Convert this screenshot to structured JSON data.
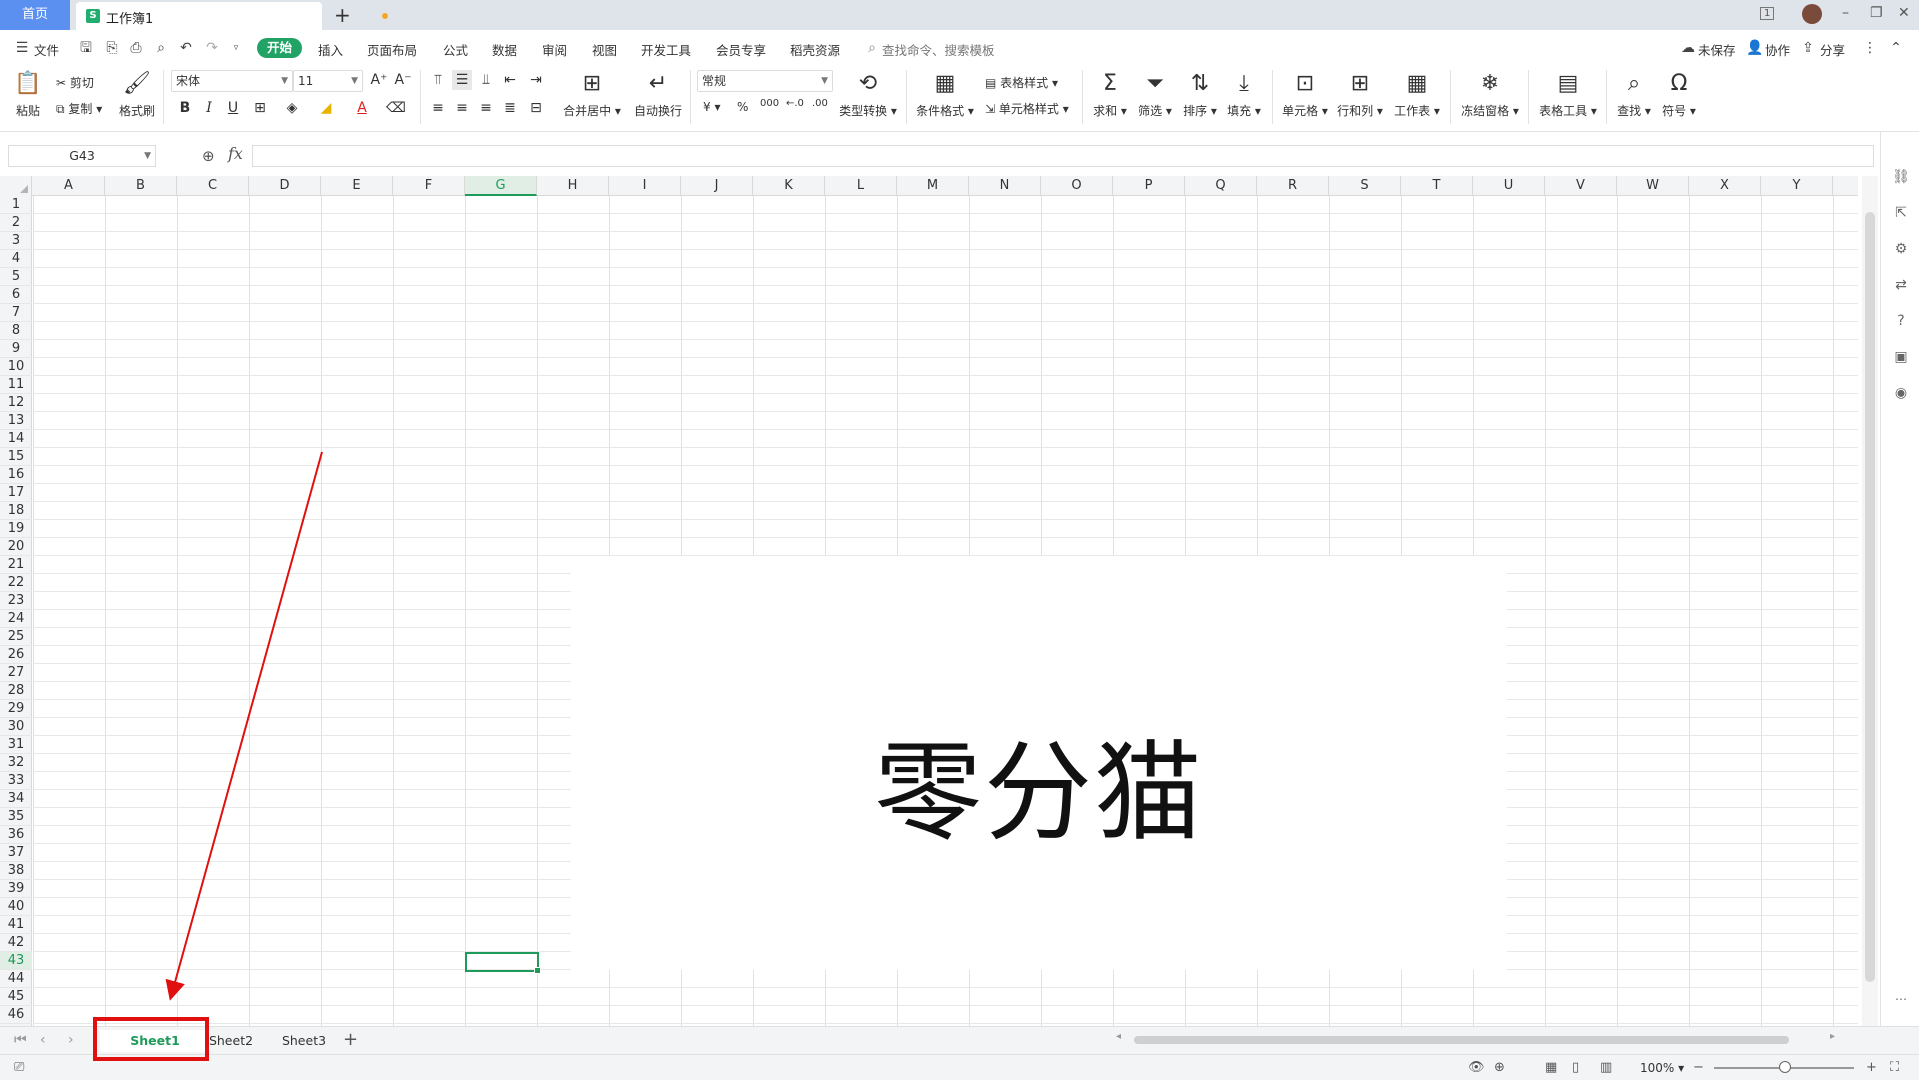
{
  "titlebar": {
    "home_tab": "首页",
    "doc_icon": "S",
    "doc_name": "工作簿1",
    "new_tab_icon": "+",
    "window_controls": [
      "1",
      "–",
      "❐",
      "✕"
    ]
  },
  "menubar": {
    "file": "文件",
    "items": [
      "开始",
      "插入",
      "页面布局",
      "公式",
      "数据",
      "审阅",
      "视图",
      "开发工具",
      "会员专享",
      "稻壳资源"
    ],
    "search_placeholder": "查找命令、搜索模板",
    "right_actions": [
      "未保存",
      "协作",
      "分享"
    ]
  },
  "ribbon": {
    "paste": "粘贴",
    "cut": "剪切",
    "copy": "复制",
    "format_painter": "格式刷",
    "font_name": "宋体",
    "font_size": "11",
    "merge_center": "合并居中",
    "auto_wrap": "自动换行",
    "number_format": "常规",
    "currency": "¥",
    "percent": "%",
    "thousand": "000",
    "type_convert": "类型转换",
    "cond_format": "条件格式",
    "table_style": "表格样式",
    "cell_style": "单元格样式",
    "sum": "求和",
    "filter": "筛选",
    "sort": "排序",
    "fill": "填充",
    "cell": "单元格",
    "row_col": "行和列",
    "worksheet": "工作表",
    "freeze": "冻结窗格",
    "table_tools": "表格工具",
    "find": "查找",
    "symbol": "符号"
  },
  "formula_bar": {
    "name_box": "G43",
    "fx": "fx",
    "value": ""
  },
  "columns": [
    "A",
    "B",
    "C",
    "D",
    "E",
    "F",
    "G",
    "H",
    "I",
    "J",
    "K",
    "L",
    "M",
    "N",
    "O",
    "P",
    "Q",
    "R",
    "S",
    "T",
    "U",
    "V",
    "W",
    "X",
    "Y"
  ],
  "selected_column": "G",
  "rows": [
    "1",
    "2",
    "3",
    "4",
    "5",
    "6",
    "7",
    "8",
    "9",
    "10",
    "11",
    "12",
    "13",
    "14",
    "15",
    "16",
    "17",
    "18",
    "19",
    "20",
    "21",
    "22",
    "23",
    "24",
    "25",
    "26",
    "27",
    "28",
    "29",
    "30",
    "31",
    "32",
    "33",
    "34",
    "35",
    "36",
    "37",
    "38",
    "39",
    "40",
    "41",
    "42",
    "43",
    "44",
    "45",
    "46"
  ],
  "selected_row": "43",
  "image_overlay_text": "零分猫",
  "sheets": [
    "Sheet1",
    "Sheet2",
    "Sheet3"
  ],
  "active_sheet": "Sheet1",
  "add_sheet_icon": "+",
  "status": {
    "zoom": "100%",
    "zoom_level_fraction": 0.46
  },
  "colors": {
    "accent_green": "#21a366",
    "home_tab_blue": "#5b8ff0",
    "annotation_red": "#e01010"
  }
}
